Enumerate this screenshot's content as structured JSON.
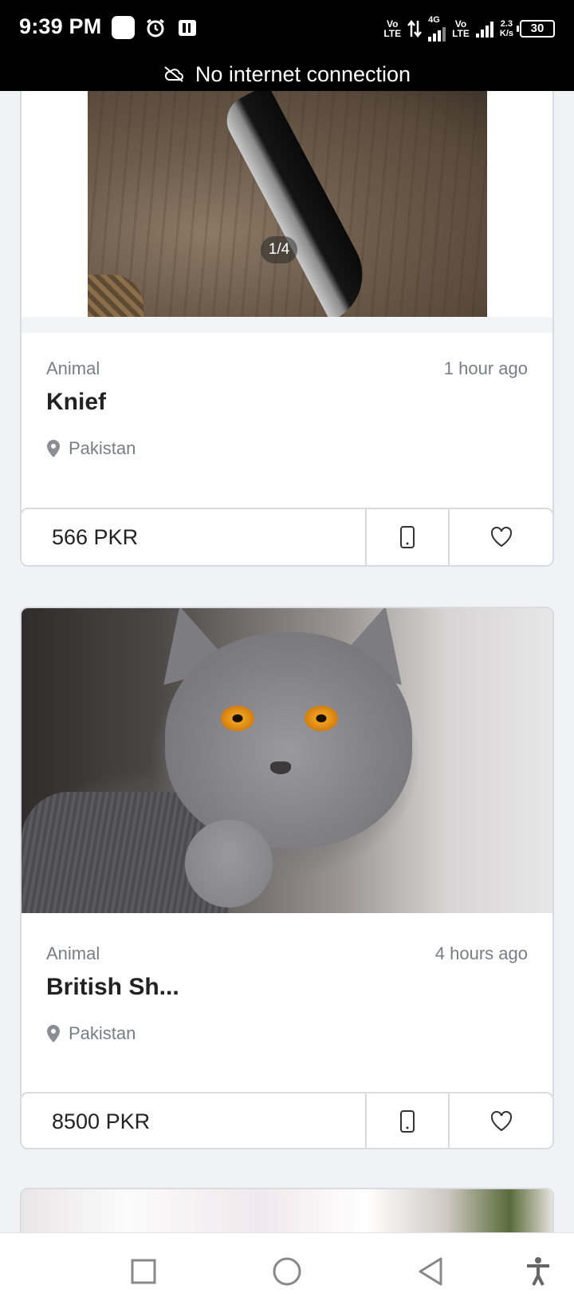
{
  "status_bar": {
    "time": "9:39 PM",
    "network_1": "4G",
    "volte_1_top": "Vo",
    "volte_1_bottom": "LTE",
    "volte_2_top": "Vo",
    "volte_2_bottom": "LTE",
    "speed_value": "2.3",
    "speed_unit": "K/s",
    "battery": "30"
  },
  "banner": {
    "text": "No internet connection",
    "icon": "cloud-off-icon"
  },
  "listings": [
    {
      "image_counter": "1/4",
      "category": "Animal",
      "time": "1 hour ago",
      "title": "Knief",
      "location": "Pakistan",
      "price": "566 PKR"
    },
    {
      "category": "Animal",
      "time": "4 hours ago",
      "title": "British Sh...",
      "location": "Pakistan",
      "price": "8500 PKR"
    }
  ],
  "icons": {
    "location": "map-pin-icon",
    "call": "phone-icon",
    "favorite": "heart-icon"
  },
  "nav": {
    "recents": "square-icon",
    "home": "circle-icon",
    "back": "triangle-back-icon",
    "accessibility": "accessibility-icon"
  },
  "colors": {
    "background": "#f1f2f5",
    "card_border": "#d9dbe0",
    "muted_text": "#7a7d84",
    "title_text": "#222222"
  }
}
